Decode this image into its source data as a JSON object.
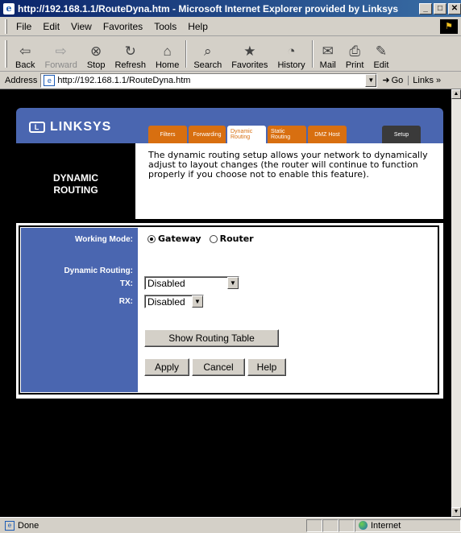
{
  "window": {
    "title": "http://192.168.1.1/RouteDyna.htm - Microsoft Internet Explorer provided by Linksys",
    "controls": {
      "minimize": "_",
      "maximize": "□",
      "close": "✕"
    }
  },
  "menu": {
    "items": [
      "File",
      "Edit",
      "View",
      "Favorites",
      "Tools",
      "Help"
    ]
  },
  "toolbar": {
    "buttons": [
      {
        "label": "Back",
        "icon": "back-arrow-icon"
      },
      {
        "label": "Forward",
        "icon": "forward-arrow-icon"
      },
      {
        "label": "Stop",
        "icon": "stop-icon"
      },
      {
        "label": "Refresh",
        "icon": "refresh-icon"
      },
      {
        "label": "Home",
        "icon": "home-icon"
      },
      {
        "label": "Search",
        "icon": "search-icon"
      },
      {
        "label": "Favorites",
        "icon": "favorites-icon"
      },
      {
        "label": "History",
        "icon": "history-icon"
      },
      {
        "label": "Mail",
        "icon": "mail-icon"
      },
      {
        "label": "Print",
        "icon": "print-icon"
      },
      {
        "label": "Edit",
        "icon": "edit-icon"
      }
    ]
  },
  "address": {
    "label": "Address",
    "url": "http://192.168.1.1/RouteDyna.htm",
    "go": "Go",
    "links": "Links »"
  },
  "page": {
    "brand": "LINKSYS",
    "tabs": {
      "filters": "Filters",
      "forwarding": "Forwarding",
      "dynamic_routing": "Dynamic Routing",
      "static_routing": "Static Routing",
      "dmz_host": "DMZ Host",
      "setup": "Setup"
    },
    "section_title_line1": "DYNAMIC",
    "section_title_line2": "ROUTING",
    "description": "The dynamic routing setup allows your network to dynamically adjust to layout changes (the router will continue to function properly if you choose not to enable this feature).",
    "working_mode_label": "Working Mode:",
    "working_mode_options": {
      "gateway": "Gateway",
      "router": "Router"
    },
    "working_mode_selected": "Gateway",
    "dynamic_routing_label": "Dynamic Routing:",
    "tx_label": "TX:",
    "tx_value": "Disabled",
    "rx_label": "RX:",
    "rx_value": "Disabled",
    "show_routing_table": "Show Routing Table",
    "apply": "Apply",
    "cancel": "Cancel",
    "help": "Help"
  },
  "status": {
    "text": "Done",
    "zone": "Internet"
  },
  "colors": {
    "header_blue": "#4a66b0",
    "tab_orange": "#d86f10",
    "titlebar": "#0a246a"
  }
}
